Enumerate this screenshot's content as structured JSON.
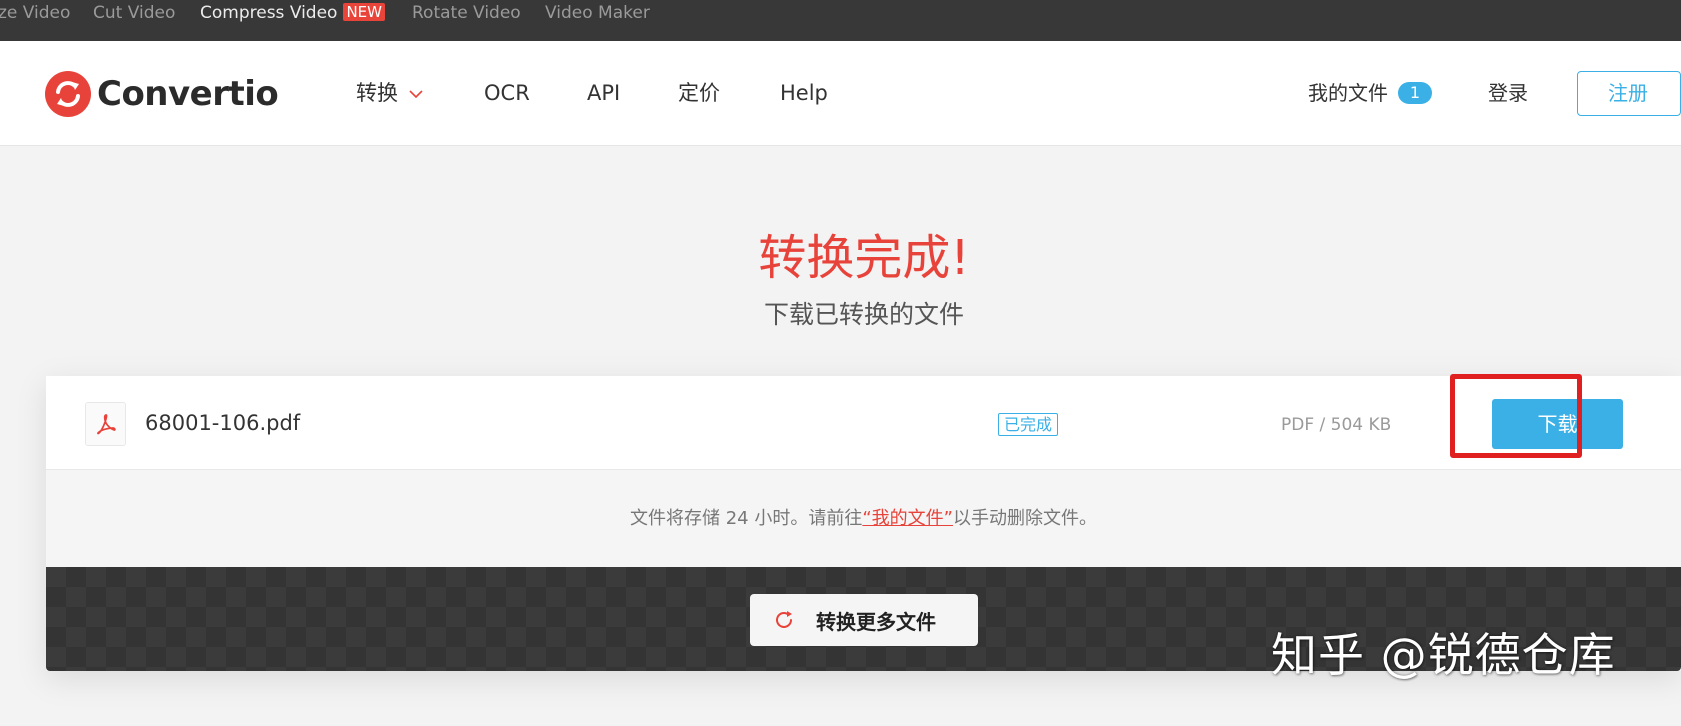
{
  "topbar": {
    "links": [
      {
        "label": "ze Video"
      },
      {
        "label": "Cut Video"
      },
      {
        "label": "Compress Video",
        "badge": "NEW"
      },
      {
        "label": "Rotate Video"
      },
      {
        "label": "Video Maker"
      }
    ]
  },
  "header": {
    "logo_text": "Convertio",
    "nav": {
      "convert": "转换",
      "ocr": "OCR",
      "api": "API",
      "pricing": "定价",
      "help": "Help"
    },
    "my_files_label": "我的文件",
    "my_files_count": "1",
    "login": "登录",
    "register": "注册"
  },
  "hero": {
    "title": "转换完成!",
    "subtitle": "下载已转换的文件"
  },
  "file": {
    "name": "68001-106.pdf",
    "status": "已完成",
    "meta": "PDF / 504 KB",
    "download_label": "下载"
  },
  "notice": {
    "before": "文件将存储 24 小时。请前往",
    "link": "“我的文件”",
    "after": "以手动删除文件。"
  },
  "more": {
    "label": "转换更多文件"
  },
  "watermark": "知乎 @锐德仓库",
  "colors": {
    "accent": "#3bb0e6",
    "brand_red": "#e8433a",
    "highlight": "#e02020"
  }
}
